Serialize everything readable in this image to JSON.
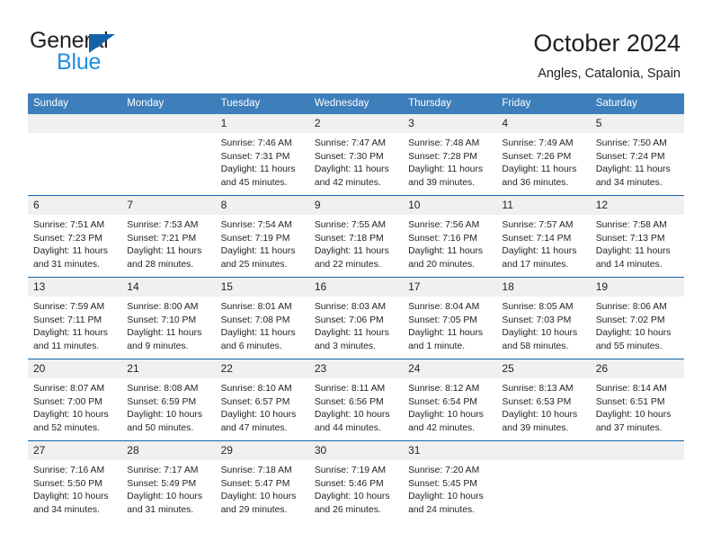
{
  "brand": {
    "name_part1": "General",
    "name_part2": "Blue",
    "flag_icon": "triangle-flag-icon"
  },
  "header": {
    "title": "October 2024",
    "subtitle": "Angles, Catalonia, Spain"
  },
  "colors": {
    "header_blue": "#3d7ebb",
    "rule_blue": "#1464aa",
    "daynum_gray": "#f0f0f0",
    "brand_blue": "#1f8fdc",
    "text": "#231f20"
  },
  "weekday_headers": [
    "Sunday",
    "Monday",
    "Tuesday",
    "Wednesday",
    "Thursday",
    "Friday",
    "Saturday"
  ],
  "labels": {
    "sunrise_prefix": "Sunrise:",
    "sunset_prefix": "Sunset:",
    "daylight_prefix": "Daylight:"
  },
  "weeks": [
    [
      {
        "day": "",
        "sunrise": "",
        "sunset": "",
        "daylight_line1": "",
        "daylight_line2": ""
      },
      {
        "day": "",
        "sunrise": "",
        "sunset": "",
        "daylight_line1": "",
        "daylight_line2": ""
      },
      {
        "day": "1",
        "sunrise": "Sunrise: 7:46 AM",
        "sunset": "Sunset: 7:31 PM",
        "daylight_line1": "Daylight: 11 hours",
        "daylight_line2": "and 45 minutes."
      },
      {
        "day": "2",
        "sunrise": "Sunrise: 7:47 AM",
        "sunset": "Sunset: 7:30 PM",
        "daylight_line1": "Daylight: 11 hours",
        "daylight_line2": "and 42 minutes."
      },
      {
        "day": "3",
        "sunrise": "Sunrise: 7:48 AM",
        "sunset": "Sunset: 7:28 PM",
        "daylight_line1": "Daylight: 11 hours",
        "daylight_line2": "and 39 minutes."
      },
      {
        "day": "4",
        "sunrise": "Sunrise: 7:49 AM",
        "sunset": "Sunset: 7:26 PM",
        "daylight_line1": "Daylight: 11 hours",
        "daylight_line2": "and 36 minutes."
      },
      {
        "day": "5",
        "sunrise": "Sunrise: 7:50 AM",
        "sunset": "Sunset: 7:24 PM",
        "daylight_line1": "Daylight: 11 hours",
        "daylight_line2": "and 34 minutes."
      }
    ],
    [
      {
        "day": "6",
        "sunrise": "Sunrise: 7:51 AM",
        "sunset": "Sunset: 7:23 PM",
        "daylight_line1": "Daylight: 11 hours",
        "daylight_line2": "and 31 minutes."
      },
      {
        "day": "7",
        "sunrise": "Sunrise: 7:53 AM",
        "sunset": "Sunset: 7:21 PM",
        "daylight_line1": "Daylight: 11 hours",
        "daylight_line2": "and 28 minutes."
      },
      {
        "day": "8",
        "sunrise": "Sunrise: 7:54 AM",
        "sunset": "Sunset: 7:19 PM",
        "daylight_line1": "Daylight: 11 hours",
        "daylight_line2": "and 25 minutes."
      },
      {
        "day": "9",
        "sunrise": "Sunrise: 7:55 AM",
        "sunset": "Sunset: 7:18 PM",
        "daylight_line1": "Daylight: 11 hours",
        "daylight_line2": "and 22 minutes."
      },
      {
        "day": "10",
        "sunrise": "Sunrise: 7:56 AM",
        "sunset": "Sunset: 7:16 PM",
        "daylight_line1": "Daylight: 11 hours",
        "daylight_line2": "and 20 minutes."
      },
      {
        "day": "11",
        "sunrise": "Sunrise: 7:57 AM",
        "sunset": "Sunset: 7:14 PM",
        "daylight_line1": "Daylight: 11 hours",
        "daylight_line2": "and 17 minutes."
      },
      {
        "day": "12",
        "sunrise": "Sunrise: 7:58 AM",
        "sunset": "Sunset: 7:13 PM",
        "daylight_line1": "Daylight: 11 hours",
        "daylight_line2": "and 14 minutes."
      }
    ],
    [
      {
        "day": "13",
        "sunrise": "Sunrise: 7:59 AM",
        "sunset": "Sunset: 7:11 PM",
        "daylight_line1": "Daylight: 11 hours",
        "daylight_line2": "and 11 minutes."
      },
      {
        "day": "14",
        "sunrise": "Sunrise: 8:00 AM",
        "sunset": "Sunset: 7:10 PM",
        "daylight_line1": "Daylight: 11 hours",
        "daylight_line2": "and 9 minutes."
      },
      {
        "day": "15",
        "sunrise": "Sunrise: 8:01 AM",
        "sunset": "Sunset: 7:08 PM",
        "daylight_line1": "Daylight: 11 hours",
        "daylight_line2": "and 6 minutes."
      },
      {
        "day": "16",
        "sunrise": "Sunrise: 8:03 AM",
        "sunset": "Sunset: 7:06 PM",
        "daylight_line1": "Daylight: 11 hours",
        "daylight_line2": "and 3 minutes."
      },
      {
        "day": "17",
        "sunrise": "Sunrise: 8:04 AM",
        "sunset": "Sunset: 7:05 PM",
        "daylight_line1": "Daylight: 11 hours",
        "daylight_line2": "and 1 minute."
      },
      {
        "day": "18",
        "sunrise": "Sunrise: 8:05 AM",
        "sunset": "Sunset: 7:03 PM",
        "daylight_line1": "Daylight: 10 hours",
        "daylight_line2": "and 58 minutes."
      },
      {
        "day": "19",
        "sunrise": "Sunrise: 8:06 AM",
        "sunset": "Sunset: 7:02 PM",
        "daylight_line1": "Daylight: 10 hours",
        "daylight_line2": "and 55 minutes."
      }
    ],
    [
      {
        "day": "20",
        "sunrise": "Sunrise: 8:07 AM",
        "sunset": "Sunset: 7:00 PM",
        "daylight_line1": "Daylight: 10 hours",
        "daylight_line2": "and 52 minutes."
      },
      {
        "day": "21",
        "sunrise": "Sunrise: 8:08 AM",
        "sunset": "Sunset: 6:59 PM",
        "daylight_line1": "Daylight: 10 hours",
        "daylight_line2": "and 50 minutes."
      },
      {
        "day": "22",
        "sunrise": "Sunrise: 8:10 AM",
        "sunset": "Sunset: 6:57 PM",
        "daylight_line1": "Daylight: 10 hours",
        "daylight_line2": "and 47 minutes."
      },
      {
        "day": "23",
        "sunrise": "Sunrise: 8:11 AM",
        "sunset": "Sunset: 6:56 PM",
        "daylight_line1": "Daylight: 10 hours",
        "daylight_line2": "and 44 minutes."
      },
      {
        "day": "24",
        "sunrise": "Sunrise: 8:12 AM",
        "sunset": "Sunset: 6:54 PM",
        "daylight_line1": "Daylight: 10 hours",
        "daylight_line2": "and 42 minutes."
      },
      {
        "day": "25",
        "sunrise": "Sunrise: 8:13 AM",
        "sunset": "Sunset: 6:53 PM",
        "daylight_line1": "Daylight: 10 hours",
        "daylight_line2": "and 39 minutes."
      },
      {
        "day": "26",
        "sunrise": "Sunrise: 8:14 AM",
        "sunset": "Sunset: 6:51 PM",
        "daylight_line1": "Daylight: 10 hours",
        "daylight_line2": "and 37 minutes."
      }
    ],
    [
      {
        "day": "27",
        "sunrise": "Sunrise: 7:16 AM",
        "sunset": "Sunset: 5:50 PM",
        "daylight_line1": "Daylight: 10 hours",
        "daylight_line2": "and 34 minutes."
      },
      {
        "day": "28",
        "sunrise": "Sunrise: 7:17 AM",
        "sunset": "Sunset: 5:49 PM",
        "daylight_line1": "Daylight: 10 hours",
        "daylight_line2": "and 31 minutes."
      },
      {
        "day": "29",
        "sunrise": "Sunrise: 7:18 AM",
        "sunset": "Sunset: 5:47 PM",
        "daylight_line1": "Daylight: 10 hours",
        "daylight_line2": "and 29 minutes."
      },
      {
        "day": "30",
        "sunrise": "Sunrise: 7:19 AM",
        "sunset": "Sunset: 5:46 PM",
        "daylight_line1": "Daylight: 10 hours",
        "daylight_line2": "and 26 minutes."
      },
      {
        "day": "31",
        "sunrise": "Sunrise: 7:20 AM",
        "sunset": "Sunset: 5:45 PM",
        "daylight_line1": "Daylight: 10 hours",
        "daylight_line2": "and 24 minutes."
      },
      {
        "day": "",
        "sunrise": "",
        "sunset": "",
        "daylight_line1": "",
        "daylight_line2": ""
      },
      {
        "day": "",
        "sunrise": "",
        "sunset": "",
        "daylight_line1": "",
        "daylight_line2": ""
      }
    ]
  ]
}
